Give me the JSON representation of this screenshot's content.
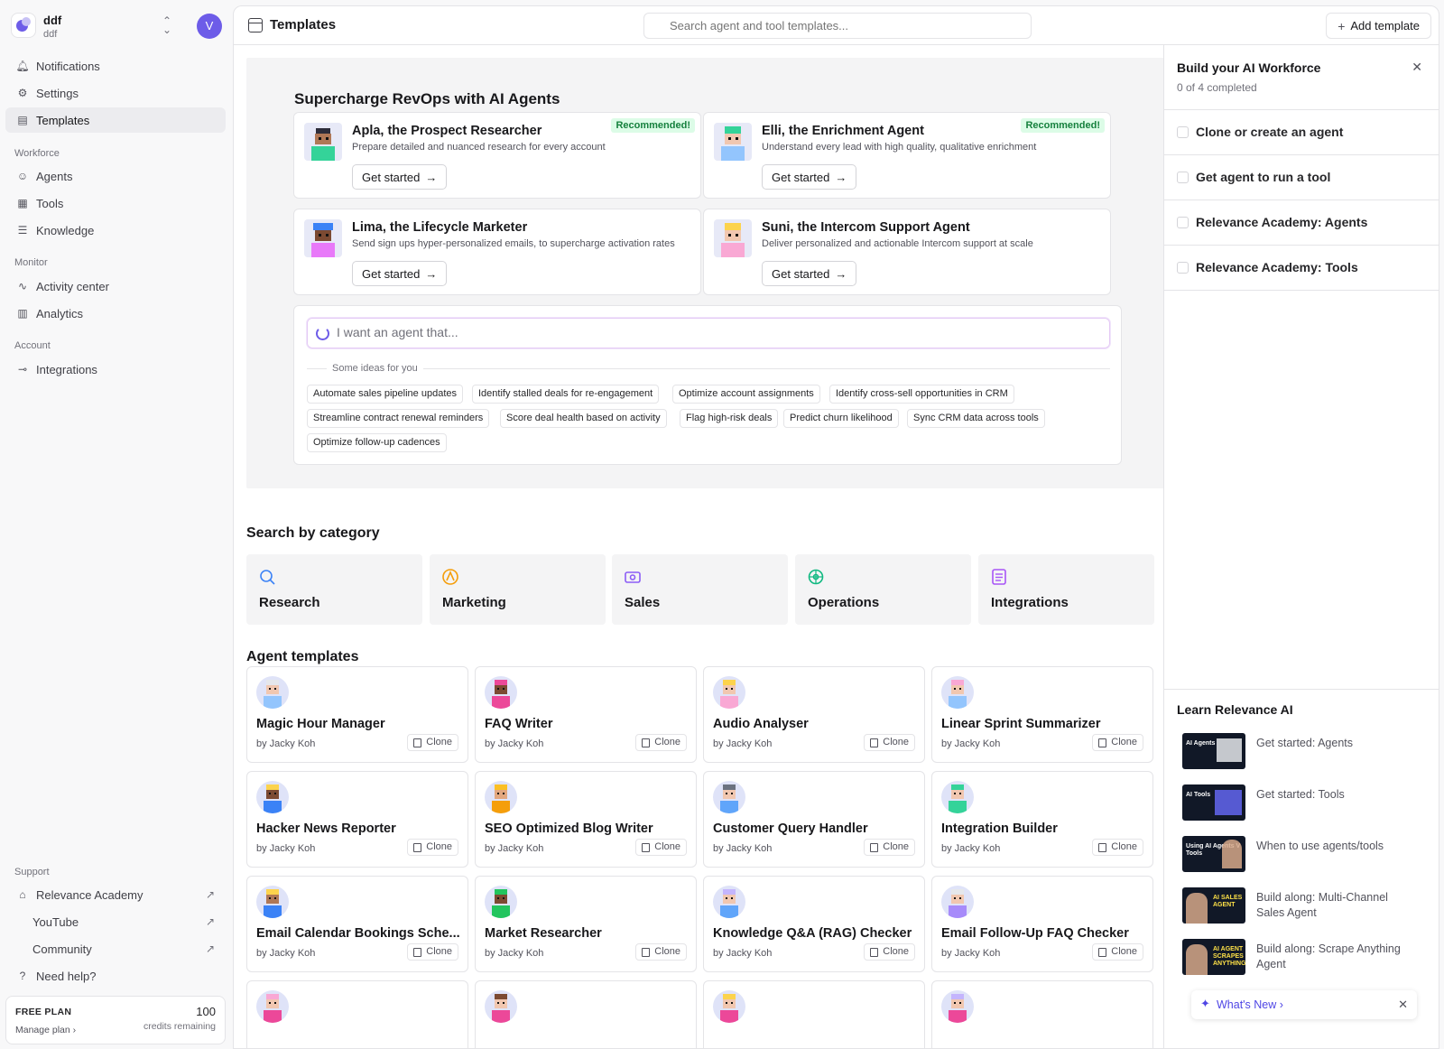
{
  "workspace": {
    "name": "ddf",
    "sub": "ddf",
    "avatar_initial": "V"
  },
  "nav": {
    "notifications": "Notifications",
    "settings": "Settings",
    "templates": "Templates",
    "workforce_section": "Workforce",
    "agents": "Agents",
    "tools": "Tools",
    "knowledge": "Knowledge",
    "monitor_section": "Monitor",
    "activity": "Activity center",
    "analytics": "Analytics",
    "account_section": "Account",
    "integrations": "Integrations",
    "support_section": "Support",
    "academy": "Relevance Academy",
    "youtube": "YouTube",
    "community": "Community",
    "help": "Need help?"
  },
  "plan": {
    "label": "FREE PLAN",
    "manage": "Manage plan",
    "credits": "100",
    "remaining": "credits remaining"
  },
  "header": {
    "title": "Templates",
    "search_placeholder": "Search agent and tool templates...",
    "add_label": "Add template"
  },
  "hero": {
    "title": "Supercharge RevOps with AI Agents",
    "cards": [
      {
        "name": "Apla, the Prospect Researcher",
        "desc": "Prepare detailed and nuanced research for every account",
        "badge": "Recommended!",
        "cta": "Get started"
      },
      {
        "name": "Elli, the Enrichment Agent",
        "desc": "Understand every lead with high quality, qualitative enrichment",
        "badge": "Recommended!",
        "cta": "Get started"
      },
      {
        "name": "Lima, the Lifecycle Marketer",
        "desc": "Send sign ups hyper-personalized emails, to supercharge activation rates",
        "badge": "",
        "cta": "Get started"
      },
      {
        "name": "Suni, the Intercom Support Agent",
        "desc": "Deliver personalized and actionable Intercom support at scale",
        "badge": "",
        "cta": "Get started"
      }
    ],
    "prompt_placeholder": "I want an agent that...",
    "ideas_label": "Some ideas for you",
    "ideas": [
      "Automate sales pipeline updates",
      "Identify stalled deals for re-engagement",
      "Optimize account assignments",
      "Identify cross-sell opportunities in CRM",
      "Streamline contract renewal reminders",
      "Score deal health based on activity",
      "Flag high-risk deals",
      "Predict churn likelihood",
      "Sync CRM data across tools",
      "Optimize follow-up cadences"
    ]
  },
  "categories": {
    "title": "Search by category",
    "items": [
      {
        "label": "Research",
        "icon": "search-icon",
        "color": "#3b82f6"
      },
      {
        "label": "Marketing",
        "icon": "marketing-icon",
        "color": "#f59e0b"
      },
      {
        "label": "Sales",
        "icon": "sales-icon",
        "color": "#8b5cf6"
      },
      {
        "label": "Operations",
        "icon": "operations-icon",
        "color": "#10b981"
      },
      {
        "label": "Integrations",
        "icon": "integrations-icon",
        "color": "#a855f7"
      }
    ]
  },
  "agent_templates": {
    "title": "Agent templates",
    "clone_label": "Clone",
    "items": [
      {
        "name": "Magic Hour Manager",
        "author": "by Jacky Koh"
      },
      {
        "name": "FAQ Writer",
        "author": "by Jacky Koh"
      },
      {
        "name": "Audio Analyser",
        "author": "by Jacky Koh"
      },
      {
        "name": "Linear Sprint Summarizer",
        "author": "by Jacky Koh"
      },
      {
        "name": "Hacker News Reporter",
        "author": "by Jacky Koh"
      },
      {
        "name": "SEO Optimized Blog Writer",
        "author": "by Jacky Koh"
      },
      {
        "name": "Customer Query Handler",
        "author": "by Jacky Koh"
      },
      {
        "name": "Integration Builder",
        "author": "by Jacky Koh"
      },
      {
        "name": "Email Calendar Bookings Sche...",
        "author": "by Jacky Koh"
      },
      {
        "name": "Market Researcher",
        "author": "by Jacky Koh"
      },
      {
        "name": "Knowledge Q&A (RAG) Checker",
        "author": "by Jacky Koh"
      },
      {
        "name": "Email Follow-Up FAQ Checker",
        "author": "by Jacky Koh"
      }
    ]
  },
  "onboarding": {
    "title": "Build your AI Workforce",
    "progress": "0 of 4 completed",
    "tasks": [
      "Clone or create an agent",
      "Get agent to run a tool",
      "Relevance Academy: Agents",
      "Relevance Academy: Tools"
    ]
  },
  "learn": {
    "title": "Learn Relevance AI",
    "videos": [
      {
        "label": "Get started: Agents",
        "thumb": "AI Agents"
      },
      {
        "label": "Get started: Tools",
        "thumb": "AI Tools"
      },
      {
        "label": "When to use agents/tools",
        "thumb": "Using AI Agents V Tools"
      },
      {
        "label": "Build along: Multi-Channel Sales Agent",
        "thumb": "AI SALES AGENT"
      },
      {
        "label": "Build along: Scrape Anything Agent",
        "thumb": "AI AGENT SCRAPES ANYTHING"
      }
    ],
    "whats_new": "What's New"
  }
}
